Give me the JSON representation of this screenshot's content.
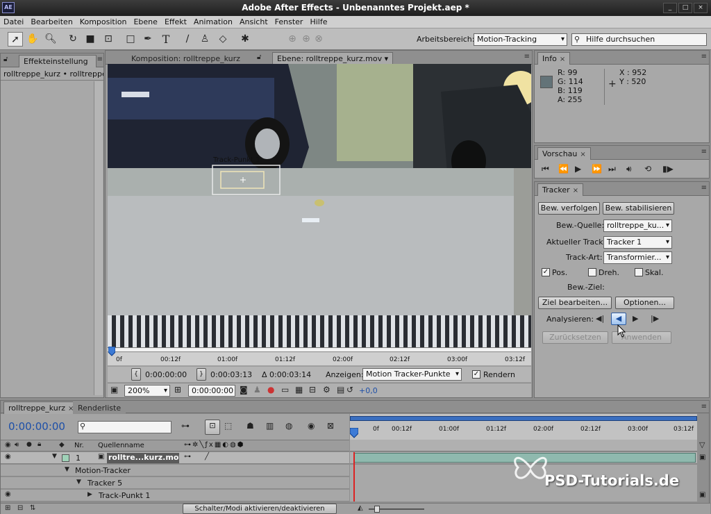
{
  "app": {
    "title": "Adobe After Effects - Unbenanntes Projekt.aep *",
    "logo": "AE",
    "window_buttons": [
      "_",
      "□",
      "×"
    ]
  },
  "menu": [
    "Datei",
    "Bearbeiten",
    "Komposition",
    "Ebene",
    "Effekt",
    "Animation",
    "Ansicht",
    "Fenster",
    "Hilfe"
  ],
  "toolbar": {
    "icons": [
      "selection-tool-icon",
      "hand-tool-icon",
      "zoom-tool-icon",
      "rotate-tool-icon",
      "camera-tool-icon",
      "pan-behind-tool-icon",
      "rectangle-tool-icon",
      "pen-tool-icon",
      "type-tool-icon",
      "brush-tool-icon",
      "clone-stamp-tool-icon",
      "eraser-tool-icon",
      "puppet-tool-icon"
    ],
    "workspace_label": "Arbeitsbereich:",
    "workspace_value": "Motion-Tracking",
    "help_placeholder": "Hilfe durchsuchen"
  },
  "effects_panel": {
    "tab": "Effekteinstellung",
    "breadcrumb": "rolltreppe_kurz • rolltreppe_ku"
  },
  "viewer": {
    "tab_comp": "Komposition: rolltreppe_kurz",
    "tab_layer": "Ebene: rolltreppe_kurz.mov",
    "track_point_label": "Track-Punkt 1",
    "ruler_ticks": [
      "0f",
      "00:12f",
      "01:00f",
      "01:12f",
      "02:00f",
      "02:12f",
      "03:00f",
      "03:12f"
    ],
    "in_point": "0:00:00:00",
    "out_point": "0:00:03:13",
    "duration": "Δ 0:00:03:14",
    "show_label": "Anzeigen:",
    "show_value": "Motion Tracker-Punkte",
    "render_label": "Rendern",
    "zoom": "200%",
    "current_time": "0:00:00:00",
    "exposure": "+0,0"
  },
  "info_panel": {
    "tab": "Info",
    "r": "R:  99",
    "g": "G:  114",
    "b": "B:  119",
    "a": "A:  255",
    "x": "X : 952",
    "y": "Y : 520",
    "swatch_color": "#637378"
  },
  "preview_panel": {
    "tab": "Vorschau"
  },
  "tracker_panel": {
    "tab": "Tracker",
    "btn_track": "Bew. verfolgen",
    "btn_stabilize": "Bew. stabilisieren",
    "source_label": "Bew.-Quelle:",
    "source_value": "rolltreppe_ku...",
    "current_track_label": "Aktueller Track:",
    "current_track_value": "Tracker 1",
    "track_type_label": "Track-Art:",
    "track_type_value": "Transformier...",
    "pos_label": "Pos.",
    "rot_label": "Dreh.",
    "scale_label": "Skal.",
    "target_label": "Bew.-Ziel:",
    "btn_edit_target": "Ziel bearbeiten...",
    "btn_options": "Optionen...",
    "analyze_label": "Analysieren:",
    "btn_reset": "Zurücksetzen",
    "btn_apply": "Anwenden"
  },
  "timeline": {
    "tab_comp": "rolltreppe_kurz",
    "tab_render": "Renderliste",
    "timecode": "0:00:00:00",
    "search_placeholder": "",
    "col_nr": "Nr.",
    "col_source": "Quellenname",
    "ruler_ticks": [
      "0f",
      "00:12f",
      "01:00f",
      "01:12f",
      "02:00f",
      "02:12f",
      "03:00f",
      "03:12f"
    ],
    "layer_number": "1",
    "layer_name": "rolltre...kurz.mov",
    "row_motion_tracker": "Motion-Tracker",
    "row_tracker": "Tracker 5",
    "row_track_point": "Track-Punkt 1",
    "footer_toggle": "Schalter/Modi aktivieren/deaktivieren"
  },
  "watermark": {
    "text": "PSD-Tutorials.de"
  }
}
